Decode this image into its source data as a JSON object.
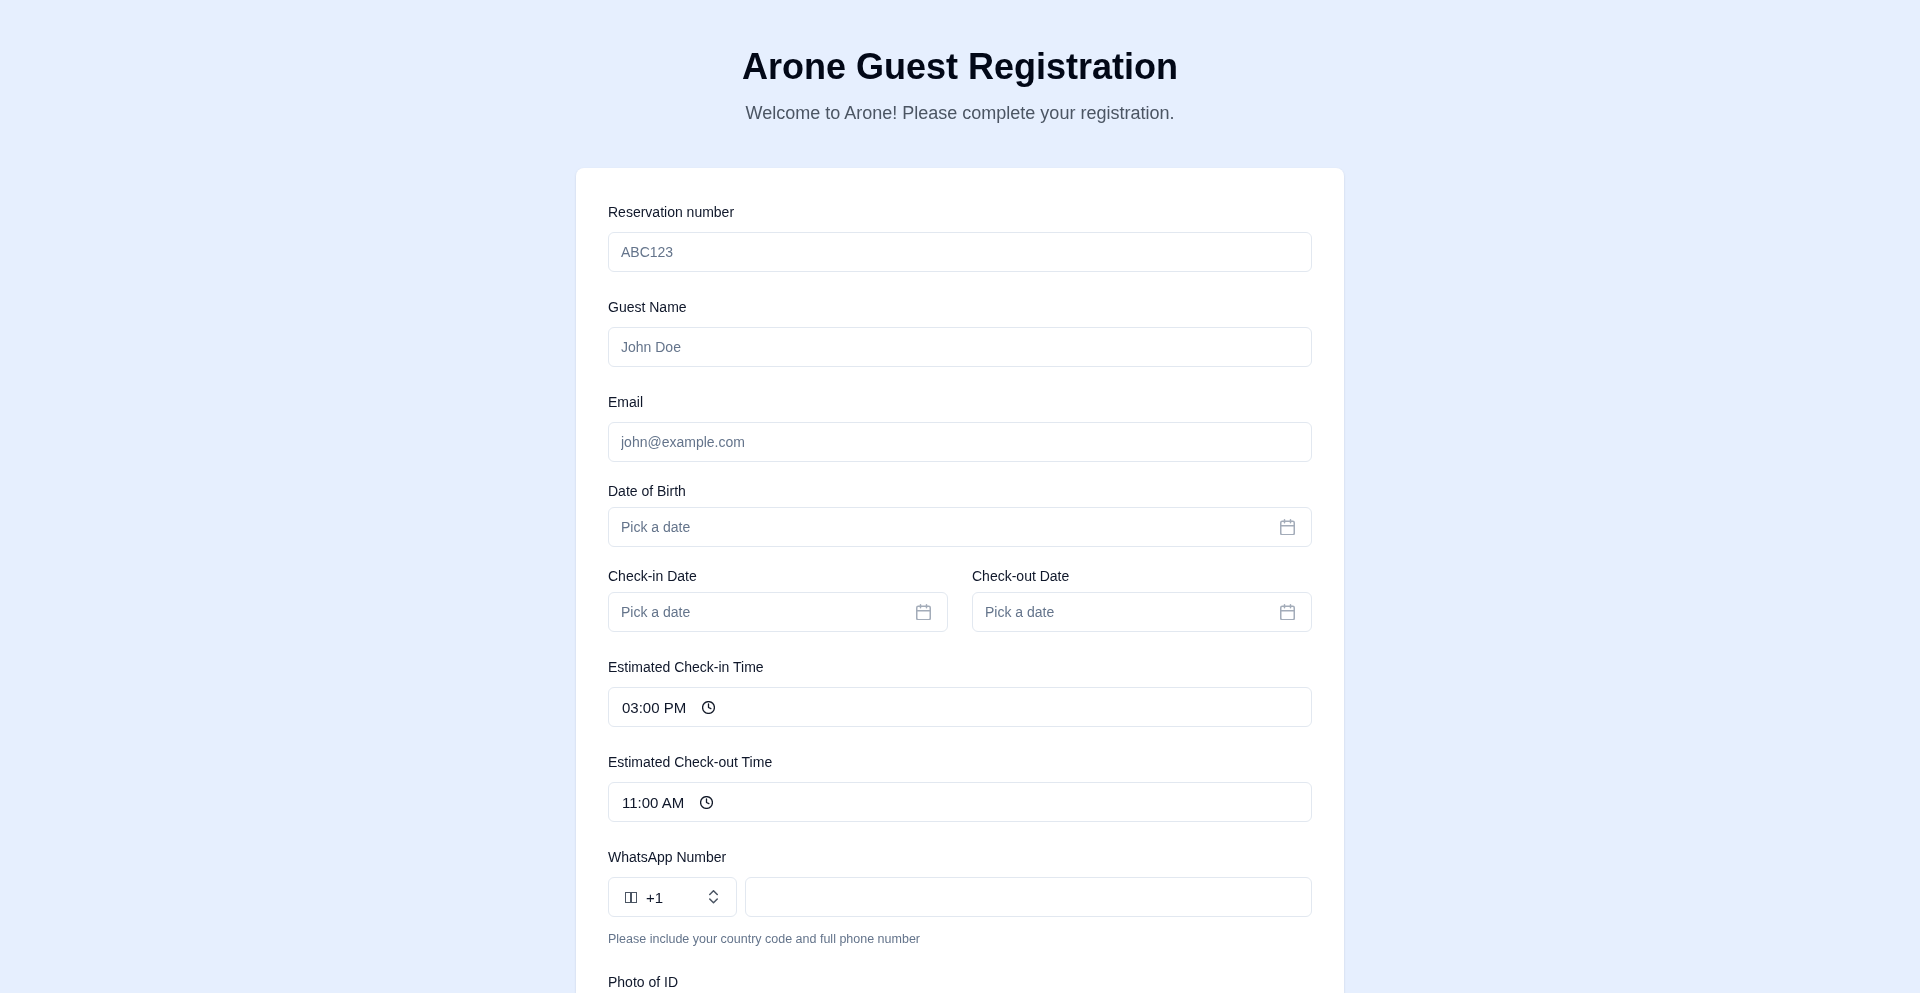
{
  "header": {
    "title": "Arone Guest Registration",
    "subtitle": "Welcome to Arone! Please complete your registration."
  },
  "form": {
    "fields": [
      {
        "kind": "text",
        "label": "Reservation number",
        "placeholder": "ABC123"
      },
      {
        "kind": "text",
        "label": "Guest Name",
        "placeholder": "John Doe"
      },
      {
        "kind": "text",
        "label": "Email",
        "placeholder": "john@example.com"
      },
      {
        "kind": "date",
        "label": "Date of Birth",
        "placeholder": "Pick a date"
      },
      {
        "kind": "pair",
        "items": [
          {
            "label": "Check-in Date",
            "placeholder": "Pick a date"
          },
          {
            "label": "Check-out Date",
            "placeholder": "Pick a date"
          }
        ]
      },
      {
        "kind": "time",
        "label": "Estimated Check-in Time",
        "value": "03:00 PM"
      },
      {
        "kind": "time",
        "label": "Estimated Check-out Time",
        "value": "11:00 AM"
      },
      {
        "kind": "phone",
        "label": "WhatsApp Number",
        "country_code": "+1",
        "hint": "Please include your country code and full phone number"
      },
      {
        "kind": "label",
        "label": "Photo of ID"
      }
    ]
  }
}
